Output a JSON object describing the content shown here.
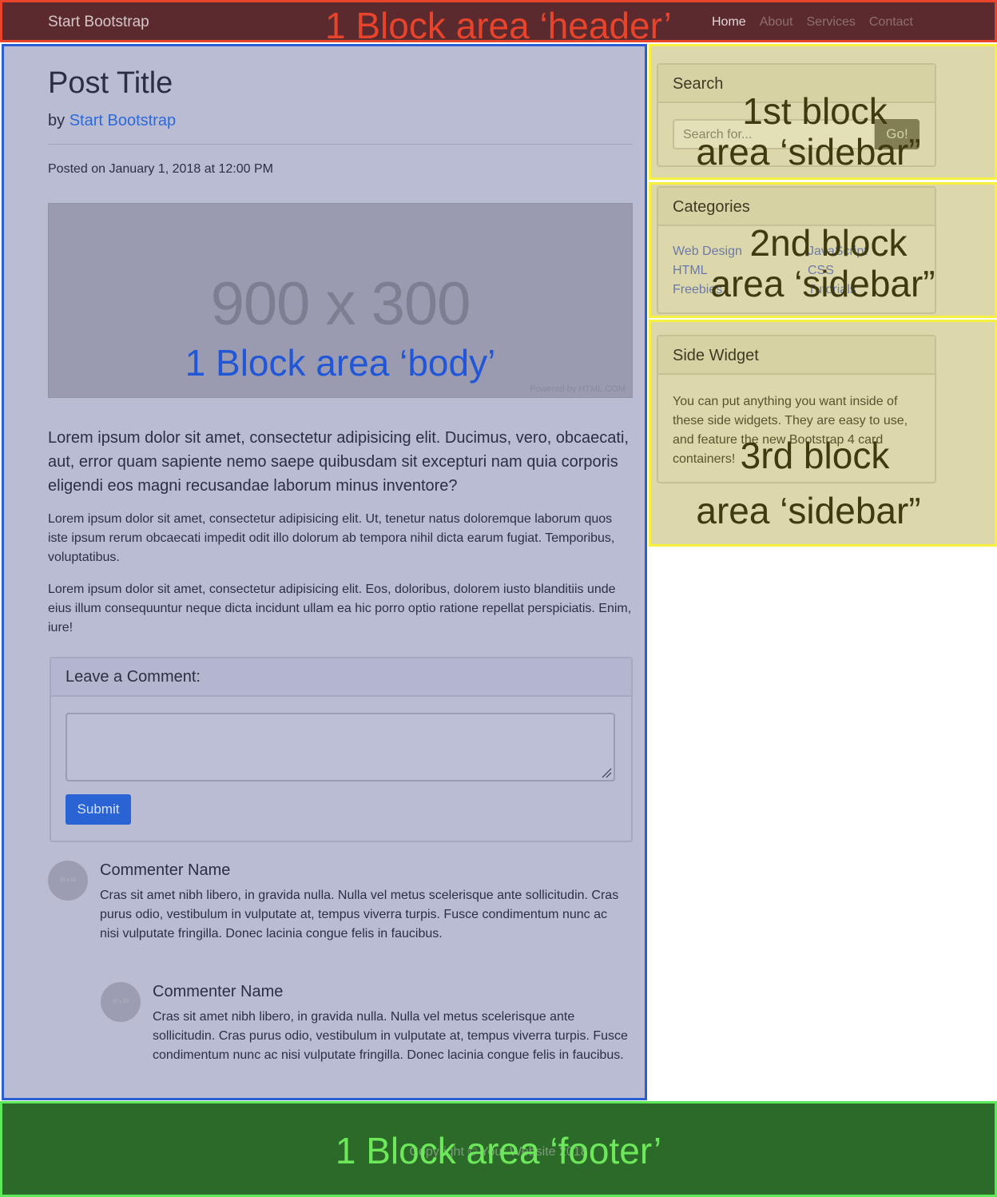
{
  "header": {
    "brand": "Start Bootstrap",
    "nav": [
      "Home",
      "About",
      "Services",
      "Contact"
    ],
    "overlay_label": "1 Block area ‘header’"
  },
  "body": {
    "post_title": "Post Title",
    "by_prefix": "by",
    "author": "Start Bootstrap",
    "posted": "Posted on January 1, 2018 at 12:00 PM",
    "image_text": "900 x 300",
    "image_powered": "Powered by HTML.COM",
    "overlay_label": "1 Block area ‘body’",
    "lead": "Lorem ipsum dolor sit amet, consectetur adipisicing elit. Ducimus, vero, obcaecati, aut, error quam sapiente nemo saepe quibusdam sit excepturi nam quia corporis eligendi eos magni recusandae laborum minus inventore?",
    "para1": "Lorem ipsum dolor sit amet, consectetur adipisicing elit. Ut, tenetur natus doloremque laborum quos iste ipsum rerum obcaecati impedit odit illo dolorum ab tempora nihil dicta earum fugiat. Temporibus, voluptatibus.",
    "para2": "Lorem ipsum dolor sit amet, consectetur adipisicing elit. Eos, doloribus, dolorem iusto blanditiis unde eius illum consequuntur neque dicta incidunt ullam ea hic porro optio ratione repellat perspiciatis. Enim, iure!",
    "comment_form": {
      "title": "Leave a Comment:",
      "submit_label": "Submit"
    },
    "comments": [
      {
        "avatar": "50 x 50",
        "name": "Commenter Name",
        "text": "Cras sit amet nibh libero, in gravida nulla. Nulla vel metus scelerisque ante sollicitudin. Cras purus odio, vestibulum in vulputate at, tempus viverra turpis. Fusce condimentum nunc ac nisi vulputate fringilla. Donec lacinia congue felis in faucibus."
      },
      {
        "avatar": "50 x 50",
        "name": "Commenter Name",
        "text": "Cras sit amet nibh libero, in gravida nulla. Nulla vel metus scelerisque ante sollicitudin. Cras purus odio, vestibulum in vulputate at, tempus viverra turpis. Fusce condimentum nunc ac nisi vulputate fringilla. Donec lacinia congue felis in faucibus."
      }
    ]
  },
  "sidebar": {
    "search": {
      "title": "Search",
      "placeholder": "Search for...",
      "button": "Go!",
      "overlay_line1": "1st block",
      "overlay_line2": "area ‘sidebar”"
    },
    "categories": {
      "title": "Categories",
      "col1": [
        "Web Design",
        "HTML",
        "Freebies"
      ],
      "col2": [
        "JavaScript",
        "CSS",
        "Tutorials"
      ],
      "overlay_line1": "2nd block",
      "overlay_line2": "area ‘sidebar”"
    },
    "widget": {
      "title": "Side Widget",
      "text": "You can put anything you want inside of these side widgets. They are easy to use, and feature the new Bootstrap 4 card containers!",
      "overlay_line1": "3rd block",
      "overlay_line2": "area ‘sidebar”"
    }
  },
  "footer": {
    "copyright": "Copyright © Your Website 2018",
    "overlay_label": "1 Block area ‘footer’"
  }
}
